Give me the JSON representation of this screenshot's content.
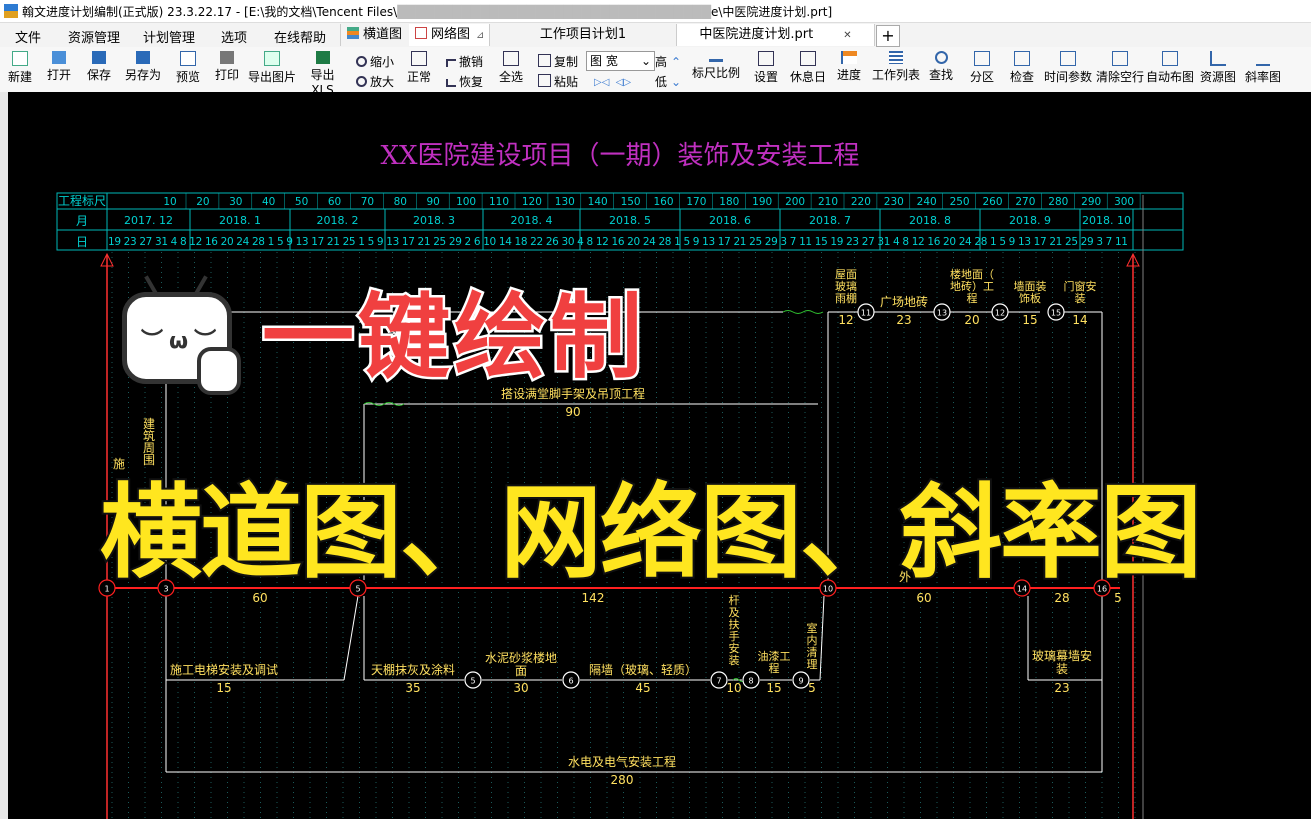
{
  "window": {
    "title": "翰文进度计划编制(正式版) 23.3.22.17 - [E:\\我的文档\\Tencent Files\\",
    "title_tail": "e\\中医院进度计划.prt]"
  },
  "menu": [
    "文件",
    "资源管理",
    "计划管理",
    "选项",
    "在线帮助"
  ],
  "tabs": [
    {
      "label": "横道图"
    },
    {
      "label": "网络图"
    },
    {
      "label": "工作项目计划1"
    },
    {
      "label": "中医院进度计划.prt"
    },
    {
      "label": "+"
    }
  ],
  "toolbar": {
    "new": "新建",
    "open": "打开",
    "save": "保存",
    "save_as": "另存为",
    "preview": "预览",
    "print": "打印",
    "export_image": "导出图片",
    "export_xls": "导出XLS",
    "zoom_out": "缩小",
    "zoom_in": "放大",
    "normal": "正常",
    "undo": "撤销",
    "redo": "恢复",
    "select_all": "全选",
    "copy": "复制",
    "paste": "粘贴",
    "width_select": "图 宽",
    "high": "高",
    "low": "低",
    "ruler_ratio": "标尺比例",
    "settings": "设置",
    "rest_day": "休息日",
    "progress": "进度",
    "task_list": "工作列表",
    "find": "查找",
    "zone": "分区",
    "check": "检查",
    "time_params": "时间参数",
    "clear_rows": "清除空行",
    "auto_layout": "自动布图",
    "resource_chart": "资源图",
    "slope_chart": "斜率图"
  },
  "chart": {
    "title": "XX医院建设项目（一期）装饰及安装工程",
    "scale_label": "工程标尺",
    "month_label": "月",
    "day_label": "日",
    "scale_ticks": [
      "10",
      "20",
      "30",
      "40",
      "50",
      "60",
      "70",
      "80",
      "90",
      "100",
      "110",
      "120",
      "130",
      "140",
      "150",
      "160",
      "170",
      "180",
      "190",
      "200",
      "210",
      "220",
      "230",
      "240",
      "250",
      "260",
      "270",
      "280",
      "290",
      "300"
    ],
    "months": [
      "2017. 12",
      "2018. 1",
      "2018. 2",
      "2018. 3",
      "2018. 4",
      "2018. 5",
      "2018. 6",
      "2018. 7",
      "2018. 8",
      "2018. 9",
      "2018. 10"
    ],
    "days": "19  23  27 31 4  8 12 16 20 24 28 1  5  9 13 17 21 25 1  5  9 13 17 21 25 29 2  6 10 14 18 22 26 30 4  8 12 16 20 24 28 1  5  9 13 17 21 25 29 3  7 11 15 19 23 27 31 4  8 12 16 20 24 28 1  5  9 13 17 21 25 29 3  7 11",
    "tasks": [
      {
        "name": "屋面玻璃雨棚",
        "dur": "12"
      },
      {
        "name": "广场地砖",
        "dur": "23"
      },
      {
        "name": "楼地面（地砖）工程",
        "dur": "20"
      },
      {
        "name": "墙面装饰板",
        "dur": "15"
      },
      {
        "name": "门窗安装",
        "dur": "14"
      },
      {
        "name": "搭设满堂脚手架及吊顶工程",
        "dur": "90"
      },
      {
        "name": "建筑周围",
        "dur": ""
      },
      {
        "name": "施",
        "dur": "60"
      },
      {
        "name": "",
        "dur": "142"
      },
      {
        "name": "外",
        "dur": "60"
      },
      {
        "name": "",
        "dur": "28"
      },
      {
        "name": "",
        "dur": "5"
      },
      {
        "name": "施工电梯安装及调试",
        "dur": "15"
      },
      {
        "name": "天棚抹灰及涂料",
        "dur": "35"
      },
      {
        "name": "水泥砂浆楼地面",
        "dur": "30"
      },
      {
        "name": "隔墙（玻璃、轻质）",
        "dur": "45"
      },
      {
        "name": "杆及扶手安装",
        "dur": "10"
      },
      {
        "name": "油漆工程",
        "dur": "15"
      },
      {
        "name": "室内清理",
        "dur": "5"
      },
      {
        "name": "玻璃幕墙安装",
        "dur": "23"
      },
      {
        "name": "水电及电气安装工程",
        "dur": "280"
      }
    ],
    "nodes": [
      "1",
      "3",
      "5",
      "6",
      "7",
      "8",
      "9",
      "10",
      "11",
      "12",
      "13",
      "14",
      "15",
      "16"
    ]
  },
  "overlay": {
    "line1": "一键绘制",
    "line2": "横道图、网络图、斜率图"
  },
  "colors": {
    "title": "#c030c0",
    "grid": "#00c0c0",
    "line": "#ffffff",
    "critical": "#ff2020",
    "label": "#ffe060",
    "overlay_yellow": "#ffe61f",
    "overlay_red": "#f04040"
  }
}
